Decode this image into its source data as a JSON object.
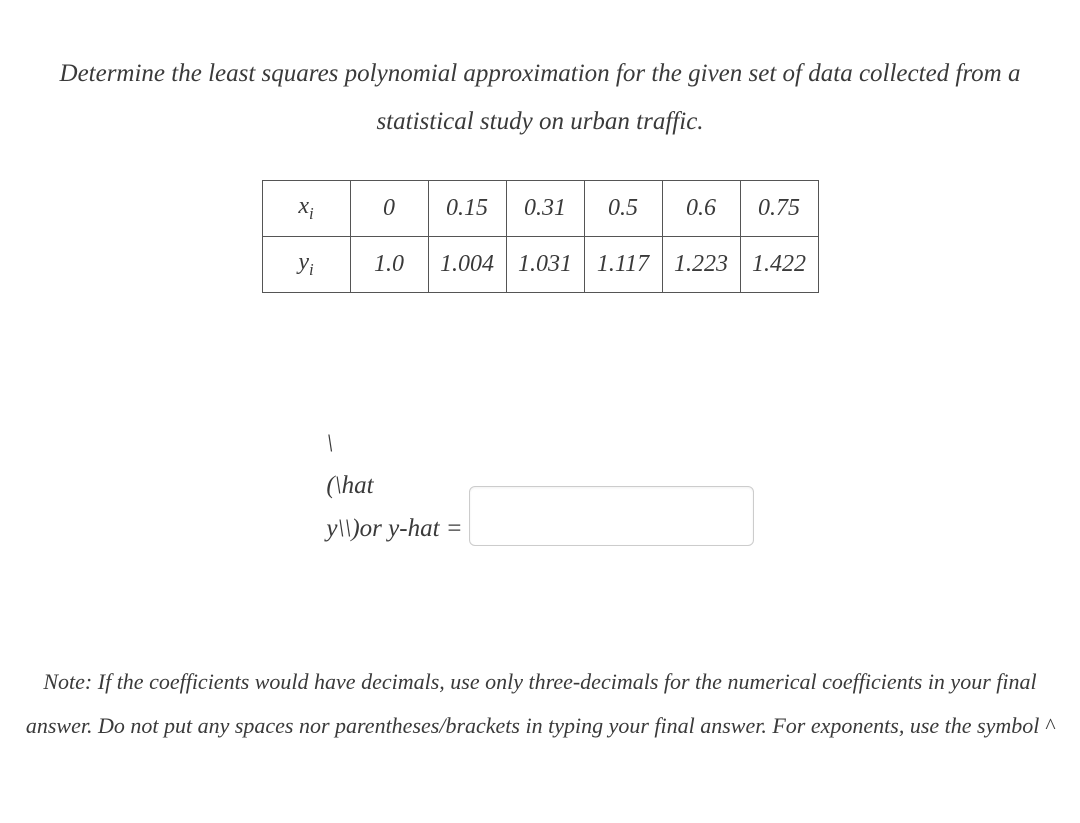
{
  "question": "Determine the least squares polynomial approximation for the given set of data collected from a statistical study on urban traffic.",
  "table": {
    "row1_label_base": "x",
    "row1_label_sub": "i",
    "row2_label_base": "y",
    "row2_label_sub": "i",
    "x_values": [
      "0",
      "0.15",
      "0.31",
      "0.5",
      "0.6",
      "0.75"
    ],
    "y_values": [
      "1.0",
      "1.004",
      "1.031",
      "1.117",
      "1.223",
      "1.422"
    ]
  },
  "answer": {
    "label_line1": "\\",
    "label_line2": "(\\hat",
    "label_line3": "y\\\\)or y-hat =",
    "value": ""
  },
  "note": "Note: If the coefficients would have decimals, use only three-decimals for the numerical coefficients in your final answer. Do not put any spaces nor parentheses/brackets in typing your final answer. For exponents, use the symbol ^"
}
